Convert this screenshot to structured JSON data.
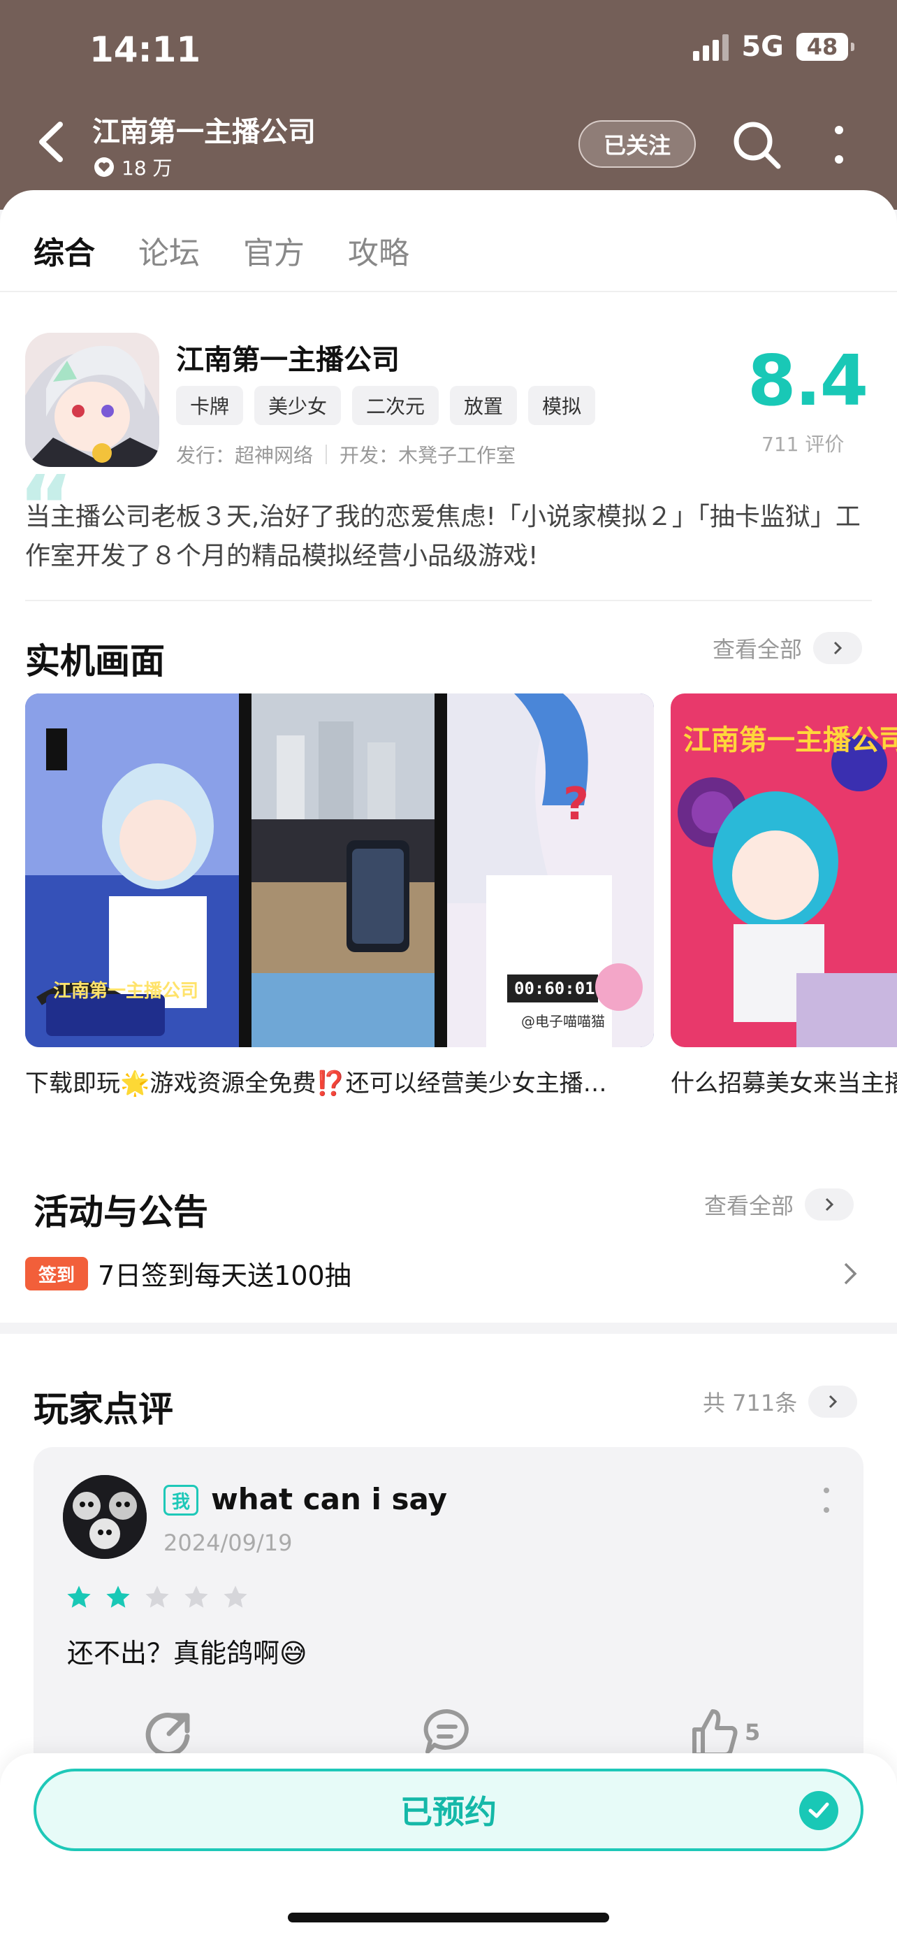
{
  "status": {
    "time": "14:11",
    "network": "5G",
    "battery": "48"
  },
  "header": {
    "title": "江南第一主播公司",
    "fans": "18 万",
    "follow_label": "已关注"
  },
  "tabs": [
    {
      "label": "综合",
      "active": true
    },
    {
      "label": "论坛",
      "active": false
    },
    {
      "label": "官方",
      "active": false
    },
    {
      "label": "攻略",
      "active": false
    }
  ],
  "game": {
    "name": "江南第一主播公司",
    "tags": [
      "卡牌",
      "美少女",
      "二次元",
      "放置",
      "模拟"
    ],
    "publisher": "发行：超神网络",
    "developer": "开发：木凳子工作室",
    "score": "8.4",
    "score_count": "711 评价",
    "description": "当主播公司老板３天,治好了我的恋爱焦虑!「小说家模拟２」「抽卡监狱」工作室开发了８个月的精品模拟经营小品级游戏!"
  },
  "screens": {
    "title": "实机画面",
    "view_all": "查看全部",
    "captions": [
      "下载即玩🌟游戏资源全免费⁉️还可以经营美少女主播…",
      "什么招募美女来当主播"
    ],
    "poster_text": "江南第一主播公司",
    "timer": "00:60:01",
    "watermark": "@电子喵喵猫"
  },
  "activity": {
    "title": "活动与公告",
    "view_all": "查看全部",
    "badge": "签到",
    "item": "7日签到每天送100抽"
  },
  "reviews": {
    "title": "玩家点评",
    "count": "共 711条",
    "items": [
      {
        "me_badge": "我",
        "user": "what can i say",
        "date": "2024/09/19",
        "rating": 2,
        "max": 5,
        "text": "还不出？真能鸽啊😅",
        "likes": "5"
      }
    ]
  },
  "bottom": {
    "reserve_label": "已预约"
  },
  "colors": {
    "accent": "#19c8b6",
    "header_bg": "#745f58",
    "badge": "#f25f3a"
  }
}
